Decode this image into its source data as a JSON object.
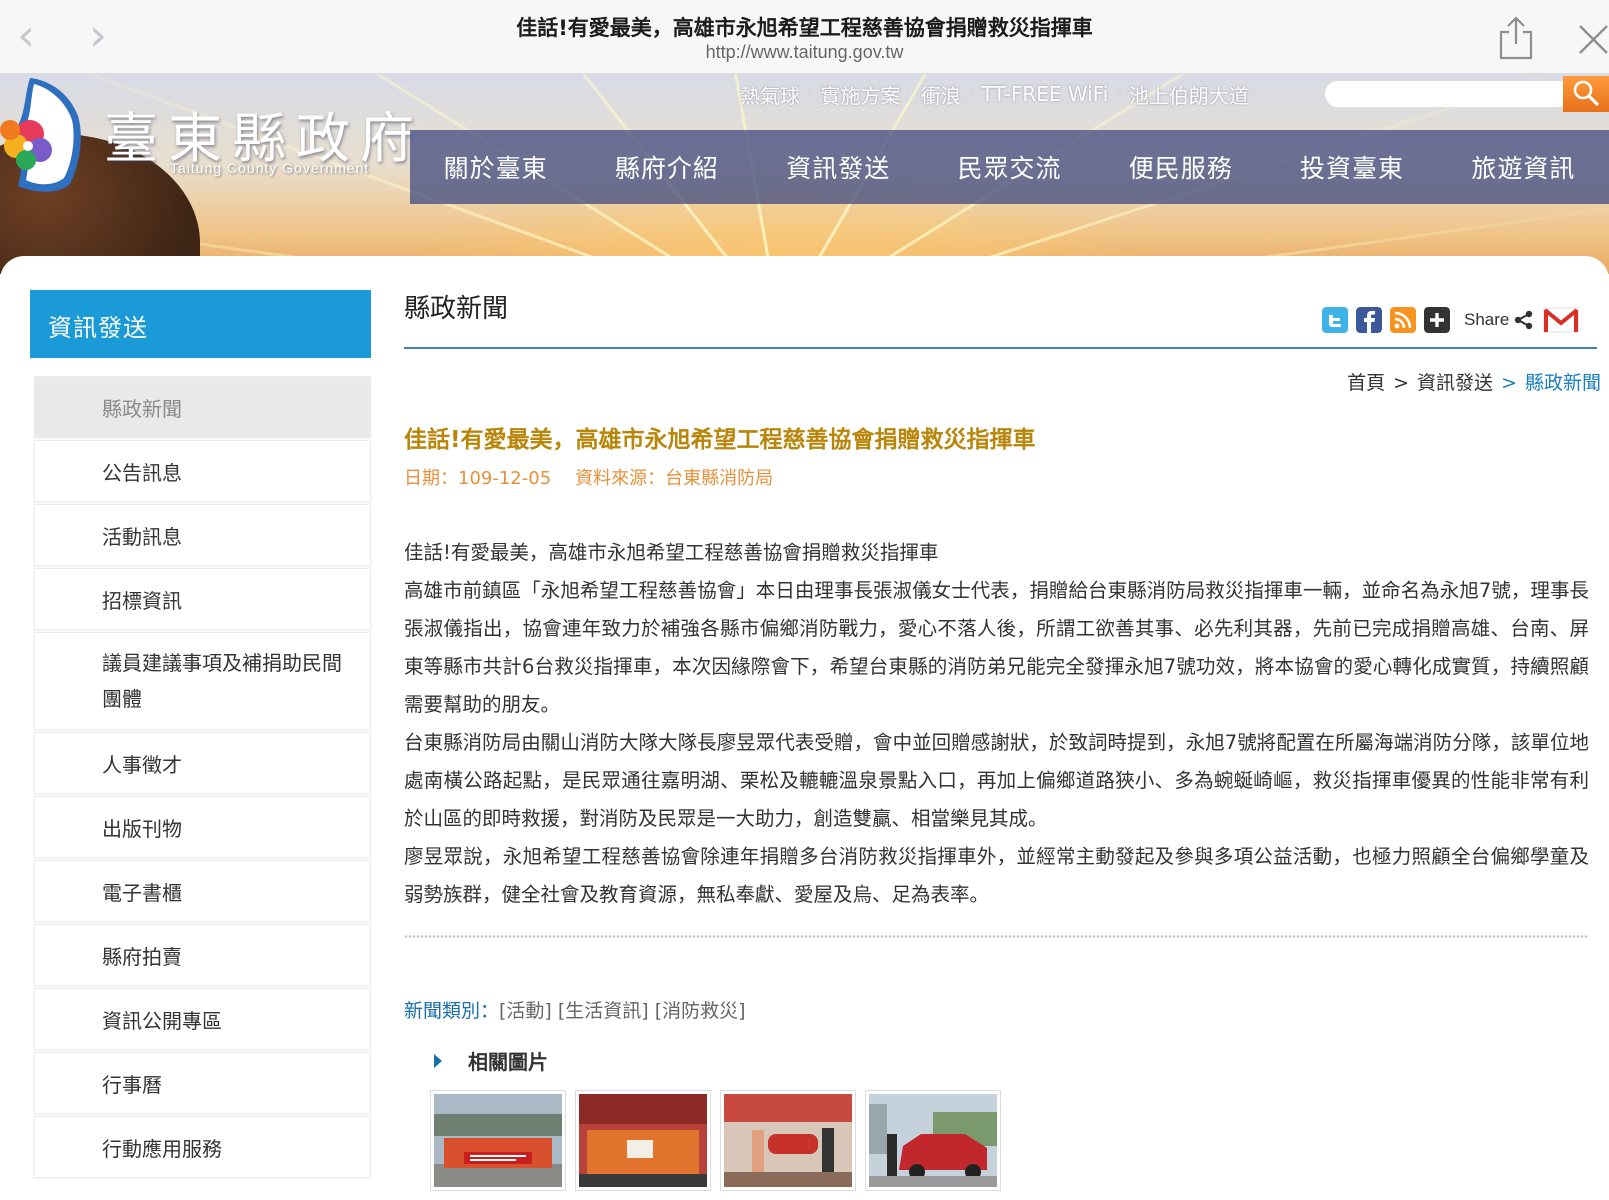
{
  "browser": {
    "title": "佳話!有愛最美，高雄市永旭希望工程慈善協會捐贈救災指揮車",
    "url": "http://www.taitung.gov.tw"
  },
  "site": {
    "name": "臺東縣政府",
    "subtitle": "Taitung County Government",
    "quick_links": [
      "熱氣球",
      "實施方案",
      "衝浪",
      "TT-FREE WiFi",
      "池上伯朗大道"
    ],
    "search_placeholder": "",
    "nav": [
      "關於臺東",
      "縣府介紹",
      "資訊發送",
      "民眾交流",
      "便民服務",
      "投資臺東",
      "旅遊資訊"
    ]
  },
  "sidebar": {
    "title": "資訊發送",
    "items": [
      {
        "label": "縣政新聞",
        "active": true
      },
      {
        "label": "公告訊息"
      },
      {
        "label": "活動訊息"
      },
      {
        "label": "招標資訊"
      },
      {
        "label": "議員建議事項及補捐助民間團體"
      },
      {
        "label": "人事徵才"
      },
      {
        "label": "出版刊物"
      },
      {
        "label": "電子書櫃"
      },
      {
        "label": "縣府拍賣"
      },
      {
        "label": "資訊公開專區"
      },
      {
        "label": "行事曆"
      },
      {
        "label": "行動應用服務"
      }
    ]
  },
  "main": {
    "section_title": "縣政新聞",
    "share_label": "Share",
    "breadcrumb": {
      "home": "首頁",
      "parent": "資訊發送",
      "current": "縣政新聞"
    },
    "article": {
      "title": "佳話!有愛最美，高雄市永旭希望工程慈善協會捐贈救災指揮車",
      "date": "日期：109-12-05",
      "source": "資料來源：台東縣消防局",
      "paragraphs": [
        "佳話!有愛最美，高雄市永旭希望工程慈善協會捐贈救災指揮車",
        "高雄市前鎮區「永旭希望工程慈善協會」本日由理事長張淑儀女士代表，捐贈給台東縣消防局救災指揮車一輛，並命名為永旭7號，理事長張淑儀指出，協會連年致力於補強各縣市偏鄉消防戰力，愛心不落人後，所謂工欲善其事、必先利其器，先前已完成捐贈高雄、台南、屏東等縣市共計6台救災指揮車，本次因緣際會下，希望台東縣的消防弟兄能完全發揮永旭7號功效，將本協會的愛心轉化成實質，持續照顧需要幫助的朋友。",
        "台東縣消防局由關山消防大隊大隊長廖昱眾代表受贈，會中並回贈感謝狀，於致詞時提到，永旭7號將配置在所屬海端消防分隊，該單位地處南橫公路起點，是民眾通往嘉明湖、栗松及轆轆溫泉景點入口，再加上偏鄉道路狹小、多為蜿蜒崎嶇，救災指揮車優異的性能非常有利於山區的即時救援，對消防及民眾是一大助力，創造雙贏、相當樂見其成。",
        "廖昱眾說，永旭希望工程慈善協會除連年捐贈多台消防救災指揮車外，並經常主動發起及參與多項公益活動，也極力照顧全台偏鄉學童及弱勢族群，健全社會及教育資源，無私奉獻、愛屋及烏、足為表率。"
      ]
    },
    "news_category_label": "新聞類別：",
    "news_categories": [
      "[活動]",
      "[生活資訊]",
      "[消防救災]"
    ],
    "related_images_label": "相關圖片"
  },
  "colors": {
    "sidebar_header": "#1a9ad6",
    "article_title": "#b8860b",
    "meta": "#e8913a",
    "link": "#1a7fbf",
    "nav_bg": "#46508c"
  }
}
